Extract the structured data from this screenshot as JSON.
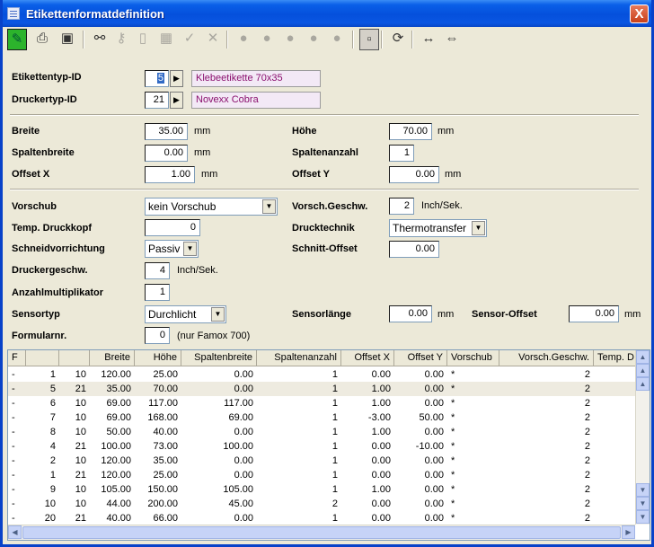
{
  "window": {
    "title": "Etikettenformatdefinition",
    "close_label": "X"
  },
  "toolbar": {
    "items": [
      {
        "name": "edit-pencil-icon",
        "glyph": "✎",
        "state": "edit"
      },
      {
        "name": "print-icon",
        "glyph": "⎙"
      },
      {
        "name": "save-icon",
        "glyph": "▣"
      },
      {
        "name": "binoculars-icon",
        "glyph": "⚯"
      },
      {
        "name": "key-icon",
        "glyph": "⚷",
        "state": "disabled"
      },
      {
        "name": "new-document-icon",
        "glyph": "▯",
        "state": "disabled"
      },
      {
        "name": "copy-icon",
        "glyph": "▦",
        "state": "disabled"
      },
      {
        "name": "check-icon",
        "glyph": "✓",
        "state": "disabled"
      },
      {
        "name": "delete-icon",
        "glyph": "✕",
        "state": "disabled"
      },
      {
        "name": "bomb-icon-1",
        "glyph": "●",
        "state": "disabled"
      },
      {
        "name": "bomb-icon-2",
        "glyph": "●",
        "state": "disabled"
      },
      {
        "name": "bomb-icon-3",
        "glyph": "●",
        "state": "disabled"
      },
      {
        "name": "bomb-icon-4",
        "glyph": "●",
        "state": "disabled"
      },
      {
        "name": "bomb-icon-5",
        "glyph": "●",
        "state": "disabled"
      },
      {
        "name": "window-icon",
        "glyph": "▫",
        "state": "pressed"
      },
      {
        "name": "refresh-icon",
        "glyph": "⟳"
      },
      {
        "name": "column-width-icon",
        "glyph": "↔"
      },
      {
        "name": "fit-columns-icon",
        "glyph": "⇔"
      }
    ]
  },
  "form": {
    "etikettentyp": {
      "label": "Etikettentyp-ID",
      "value": "5",
      "name": "Klebeetikette 70x35"
    },
    "druckertyp": {
      "label": "Druckertyp-ID",
      "value": "21",
      "name": "Novexx Cobra"
    },
    "breite": {
      "label": "Breite",
      "value": "35.00",
      "unit": "mm"
    },
    "hoehe": {
      "label": "Höhe",
      "value": "70.00",
      "unit": "mm"
    },
    "spaltenbreite": {
      "label": "Spaltenbreite",
      "value": "0.00",
      "unit": "mm"
    },
    "spaltenanzahl": {
      "label": "Spaltenanzahl",
      "value": "1"
    },
    "offset_x": {
      "label": "Offset X",
      "value": "1.00",
      "unit": "mm"
    },
    "offset_y": {
      "label": "Offset Y",
      "value": "0.00",
      "unit": "mm"
    },
    "vorschub": {
      "label": "Vorschub",
      "value": "kein Vorschub"
    },
    "vorsch_geschw": {
      "label": "Vorsch.Geschw.",
      "value": "2",
      "unit": "Inch/Sek."
    },
    "temp_druckkopf": {
      "label": "Temp. Druckkopf",
      "value": "0"
    },
    "drucktechnik": {
      "label": "Drucktechnik",
      "value": "Thermotransfer"
    },
    "schneidvorrichtung": {
      "label": "Schneidvorrichtung",
      "value": "Passiv"
    },
    "schnitt_offset": {
      "label": "Schnitt-Offset",
      "value": "0.00"
    },
    "druckergeschw": {
      "label": "Druckergeschw.",
      "value": "4",
      "unit": "Inch/Sek."
    },
    "anzahlmultiplikator": {
      "label": "Anzahlmultiplikator",
      "value": "1"
    },
    "sensortyp": {
      "label": "Sensortyp",
      "value": "Durchlicht"
    },
    "sensorlaenge": {
      "label": "Sensorlänge",
      "value": "0.00",
      "unit": "mm"
    },
    "sensor_offset": {
      "label": "Sensor-Offset",
      "value": "0.00",
      "unit": "mm"
    },
    "formularnr": {
      "label": "Formularnr.",
      "value": "0",
      "note": "(nur Famox 700)"
    }
  },
  "table": {
    "columns": [
      "F",
      "",
      "",
      "Breite",
      "Höhe",
      "Spaltenbreite",
      "Spaltenanzahl",
      "Offset X",
      "Offset Y",
      "Vorschub",
      "Vorsch.Geschw.",
      "Temp. D"
    ],
    "rows": [
      [
        "-",
        "1",
        "10",
        "120.00",
        "25.00",
        "0.00",
        "1",
        "0.00",
        "0.00",
        "*",
        "2",
        ""
      ],
      [
        "-",
        "5",
        "21",
        "35.00",
        "70.00",
        "0.00",
        "1",
        "1.00",
        "0.00",
        "*",
        "2",
        ""
      ],
      [
        "-",
        "6",
        "10",
        "69.00",
        "117.00",
        "117.00",
        "1",
        "1.00",
        "0.00",
        "*",
        "2",
        ""
      ],
      [
        "-",
        "7",
        "10",
        "69.00",
        "168.00",
        "69.00",
        "1",
        "-3.00",
        "50.00",
        "*",
        "2",
        ""
      ],
      [
        "-",
        "8",
        "10",
        "50.00",
        "40.00",
        "0.00",
        "1",
        "1.00",
        "0.00",
        "*",
        "2",
        ""
      ],
      [
        "-",
        "4",
        "21",
        "100.00",
        "73.00",
        "100.00",
        "1",
        "0.00",
        "-10.00",
        "*",
        "2",
        ""
      ],
      [
        "-",
        "2",
        "10",
        "120.00",
        "35.00",
        "0.00",
        "1",
        "0.00",
        "0.00",
        "*",
        "2",
        ""
      ],
      [
        "-",
        "1",
        "21",
        "120.00",
        "25.00",
        "0.00",
        "1",
        "0.00",
        "0.00",
        "*",
        "2",
        ""
      ],
      [
        "-",
        "9",
        "10",
        "105.00",
        "150.00",
        "105.00",
        "1",
        "1.00",
        "0.00",
        "*",
        "2",
        ""
      ],
      [
        "-",
        "10",
        "10",
        "44.00",
        "200.00",
        "45.00",
        "2",
        "0.00",
        "0.00",
        "*",
        "2",
        ""
      ],
      [
        "-",
        "20",
        "21",
        "40.00",
        "66.00",
        "0.00",
        "1",
        "0.00",
        "0.00",
        "*",
        "2",
        ""
      ]
    ]
  }
}
